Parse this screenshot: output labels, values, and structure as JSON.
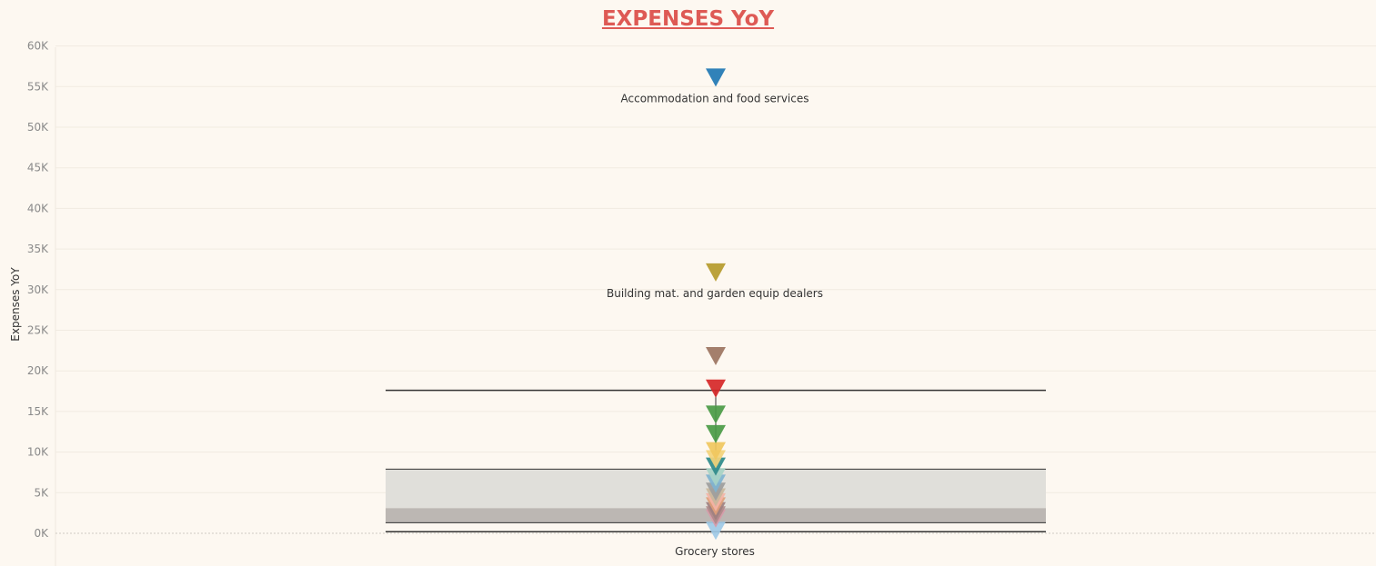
{
  "chart_data": {
    "type": "scatter",
    "title": "EXPENSES YoY",
    "ylabel": "Expenses YoY",
    "xlabel": "",
    "ylim": [
      -4000,
      60000
    ],
    "yticks": [
      0,
      5000,
      10000,
      15000,
      20000,
      25000,
      30000,
      35000,
      40000,
      45000,
      50000,
      55000,
      60000
    ],
    "ytick_labels": [
      "0K",
      "5K",
      "10K",
      "15K",
      "20K",
      "25K",
      "30K",
      "35K",
      "40K",
      "45K",
      "50K",
      "55K",
      "60K"
    ],
    "grid": true,
    "marker": "triangle-down",
    "reference_lines": {
      "whisker_top": 17600,
      "whisker_bottom": 200,
      "box_upper": 7900,
      "box_mid": 3100,
      "box_lower": 1300,
      "box_color_upper": "#e0dfda",
      "box_color_lower": "#bcb7b3",
      "line_color": "#333333"
    },
    "points": [
      {
        "label": "Accommodation and food services",
        "value": 56000,
        "color": "#1f77b4"
      },
      {
        "label": "Building mat. and garden equip dealers",
        "value": 32000,
        "color": "#b59a2b"
      },
      {
        "label": "",
        "value": 21700,
        "color": "#9c7461"
      },
      {
        "label": "",
        "value": 17700,
        "color": "#d62728"
      },
      {
        "label": "",
        "value": 14500,
        "color": "#4a9a45"
      },
      {
        "label": "",
        "value": 12100,
        "color": "#4a9a45"
      },
      {
        "label": "",
        "value": 10000,
        "color": "#f0c75e"
      },
      {
        "label": "",
        "value": 9000,
        "color": "#f3d27a"
      },
      {
        "label": "",
        "value": 8100,
        "color": "#2e8a8a"
      },
      {
        "label": "",
        "value": 6800,
        "color": "#a7d3c6"
      },
      {
        "label": "",
        "value": 6000,
        "color": "#7fb3d0"
      },
      {
        "label": "",
        "value": 5000,
        "color": "#9d9d9d"
      },
      {
        "label": "",
        "value": 4300,
        "color": "#c9b79c"
      },
      {
        "label": "",
        "value": 3700,
        "color": "#f4b4a6"
      },
      {
        "label": "",
        "value": 3200,
        "color": "#e0a07a"
      },
      {
        "label": "",
        "value": 2600,
        "color": "#a08080"
      },
      {
        "label": "",
        "value": 2100,
        "color": "#b08a8a"
      },
      {
        "label": "",
        "value": 1700,
        "color": "#d79aa8"
      },
      {
        "label": "Grocery stores",
        "value": 200,
        "color": "#9ec9e6"
      }
    ]
  }
}
